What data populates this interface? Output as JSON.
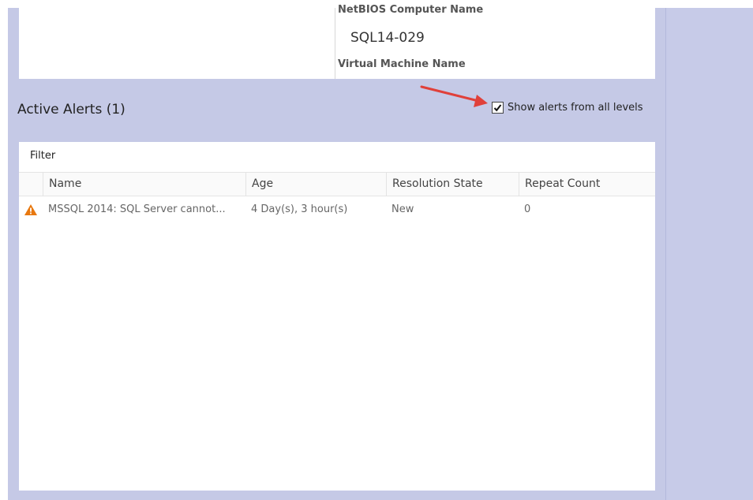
{
  "details": {
    "netbios_label": "NetBIOS Computer Name",
    "netbios_value": "SQL14-029",
    "vm_label": "Virtual Machine Name"
  },
  "alerts": {
    "title": "Active Alerts (1)",
    "show_all_levels_label": "Show alerts from all levels",
    "show_all_levels_checked": true,
    "filter_label": "Filter",
    "columns": [
      "Name",
      "Age",
      "Resolution State",
      "Repeat Count"
    ],
    "rows": [
      {
        "severity_icon": "warning-icon",
        "name": "MSSQL 2014: SQL Server cannot...",
        "age": "4 Day(s), 3 hour(s)",
        "resolution_state": "New",
        "repeat_count": "0"
      }
    ]
  },
  "colors": {
    "frame_bg": "#c5c9e6",
    "warning": "#e8780f",
    "annotation_arrow": "#e0403a"
  }
}
